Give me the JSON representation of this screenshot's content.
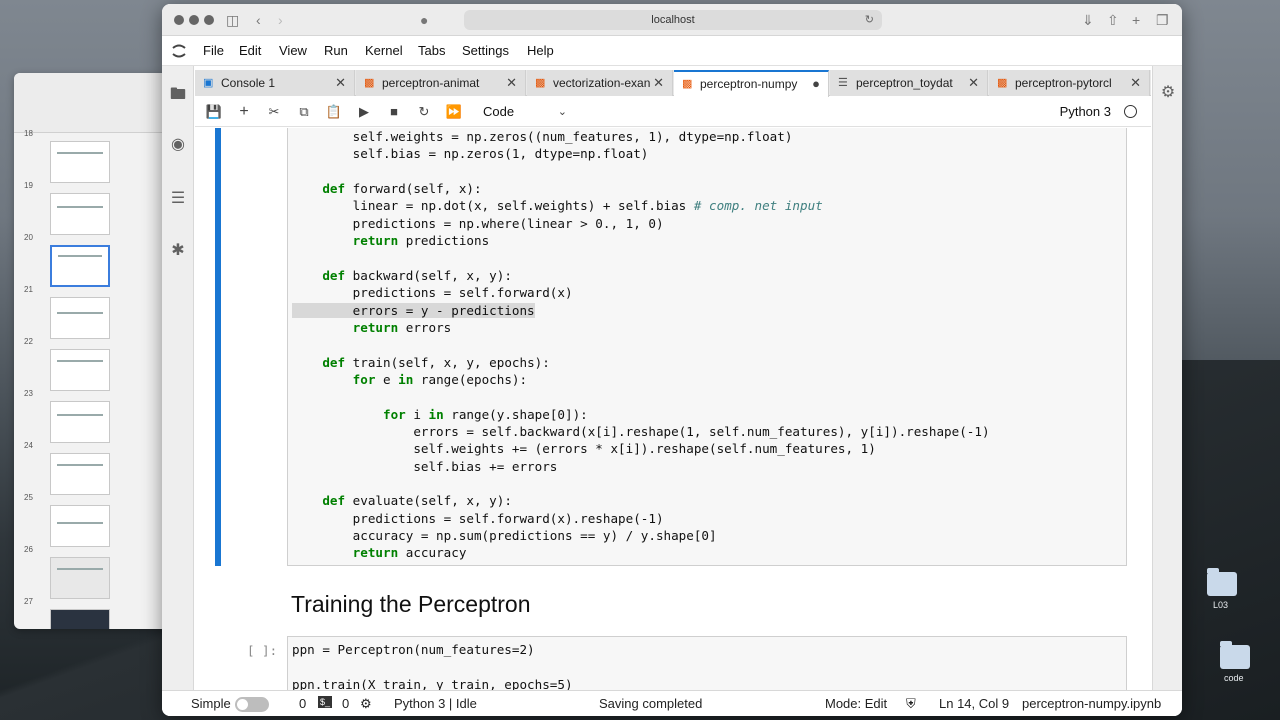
{
  "desktop": {
    "folders": [
      {
        "label": "L03"
      },
      {
        "label": "code"
      }
    ]
  },
  "slides": {
    "numbers": [
      "18",
      "19",
      "20",
      "21",
      "22",
      "23",
      "24",
      "25",
      "26",
      "27"
    ]
  },
  "browser": {
    "url": "localhost"
  },
  "menubar": {
    "items": [
      "File",
      "Edit",
      "View",
      "Run",
      "Kernel",
      "Tabs",
      "Settings",
      "Help"
    ]
  },
  "tabs": [
    {
      "label": "Console 1",
      "icon": "console-icon"
    },
    {
      "label": "perceptron-animat",
      "icon": "notebook-icon"
    },
    {
      "label": "vectorization-exan",
      "icon": "notebook-icon"
    },
    {
      "label": "perceptron-numpy",
      "icon": "notebook-icon",
      "active": true
    },
    {
      "label": "perceptron_toydat",
      "icon": "file-icon"
    },
    {
      "label": "perceptron-pytorcl",
      "icon": "notebook-icon"
    }
  ],
  "toolbar": {
    "cell_type": "Code",
    "kernel": "Python 3"
  },
  "code_lines": [
    "        self.weights = np.zeros((num_features, 1), dtype=np.float)",
    "        self.bias = np.zeros(1, dtype=np.float)",
    "",
    "    def forward(self, x):",
    "        linear = np.dot(x, self.weights) + self.bias # comp. net input",
    "        predictions = np.where(linear > 0., 1, 0)",
    "        return predictions",
    "",
    "    def backward(self, x, y):",
    "        predictions = self.forward(x)",
    "        errors = y - predictions",
    "        return errors",
    "",
    "    def train(self, x, y, epochs):",
    "        for e in range(epochs):",
    "",
    "            for i in range(y.shape[0]):",
    "                errors = self.backward(x[i].reshape(1, self.num_features), y[i]).reshape(-1)",
    "                self.weights += (errors * x[i]).reshape(self.num_features, 1)",
    "                self.bias += errors",
    "",
    "    def evaluate(self, x, y):",
    "        predictions = self.forward(x).reshape(-1)",
    "        accuracy = np.sum(predictions == y) / y.shape[0]",
    "        return accuracy"
  ],
  "markdown": {
    "heading": "Training the Perceptron"
  },
  "cell2": {
    "prompt": "[ ]:",
    "line1": "ppn = Perceptron(num_features=2)",
    "line2": "ppn.train(X_train, y_train, epochs=5)"
  },
  "statusbar": {
    "mode_simple": "Simple",
    "count_a": "0",
    "count_b": "0",
    "kernel_status": "Python 3 | Idle",
    "save_status": "Saving completed",
    "mode": "Mode: Edit",
    "cursor": "Ln 14, Col 9",
    "filename": "perceptron-numpy.ipynb"
  }
}
